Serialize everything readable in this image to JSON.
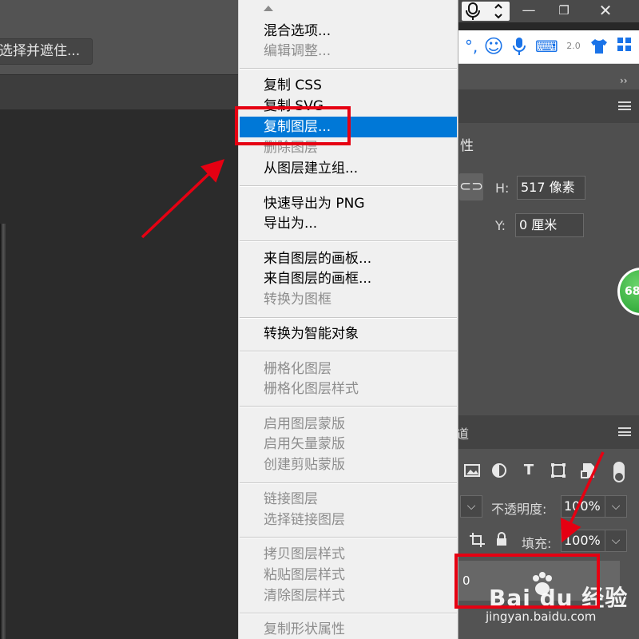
{
  "toolbar": {
    "mask_button": "选择并遮住..."
  },
  "window": {
    "min": "—",
    "max": "❐",
    "close": "✕"
  },
  "ime": {
    "icons": [
      "°,",
      "☺",
      "mic",
      "⌨",
      "2.0",
      "shirt"
    ]
  },
  "context_menu": {
    "items": [
      {
        "label": "混合选项...",
        "state": "enabled"
      },
      {
        "label": "编辑调整...",
        "state": "disabled"
      },
      {
        "label": "复制 CSS",
        "state": "enabled"
      },
      {
        "label": "复制 SVG",
        "state": "enabled"
      },
      {
        "label": "复制图层...",
        "state": "highlighted"
      },
      {
        "label": "删除图层",
        "state": "disabled"
      },
      {
        "label": "从图层建立组...",
        "state": "enabled"
      },
      {
        "label": "快速导出为 PNG",
        "state": "enabled"
      },
      {
        "label": "导出为...",
        "state": "enabled"
      },
      {
        "label": "来自图层的画板...",
        "state": "enabled"
      },
      {
        "label": "来自图层的画框...",
        "state": "enabled"
      },
      {
        "label": "转换为图框",
        "state": "disabled"
      },
      {
        "label": "转换为智能对象",
        "state": "enabled"
      },
      {
        "label": "栅格化图层",
        "state": "disabled"
      },
      {
        "label": "栅格化图层样式",
        "state": "disabled"
      },
      {
        "label": "启用图层蒙版",
        "state": "disabled"
      },
      {
        "label": "启用矢量蒙版",
        "state": "disabled"
      },
      {
        "label": "创建剪贴蒙版",
        "state": "disabled"
      },
      {
        "label": "链接图层",
        "state": "disabled"
      },
      {
        "label": "选择链接图层",
        "state": "disabled"
      },
      {
        "label": "拷贝图层样式",
        "state": "disabled"
      },
      {
        "label": "粘贴图层样式",
        "state": "disabled"
      },
      {
        "label": "清除图层样式",
        "state": "disabled"
      },
      {
        "label": "复制形状属性",
        "state": "disabled"
      }
    ]
  },
  "properties": {
    "title": "性",
    "h_label": "H:",
    "h_value": "517 像素",
    "y_label": "Y:",
    "y_value": "0 厘米"
  },
  "badge": {
    "value": "68"
  },
  "layers": {
    "tab": "道",
    "opacity_label": "不透明度:",
    "opacity_value": "100%",
    "fill_label": "填充:",
    "fill_value": "100%",
    "layer_name": "0",
    "dropdown_arrow": "⌵"
  },
  "watermark": {
    "brand": "Bai du 经验",
    "url": "jingyan.baidu.com"
  },
  "colors": {
    "highlight": "#0078d7",
    "annotation": "#e60012",
    "panel": "#535353"
  }
}
